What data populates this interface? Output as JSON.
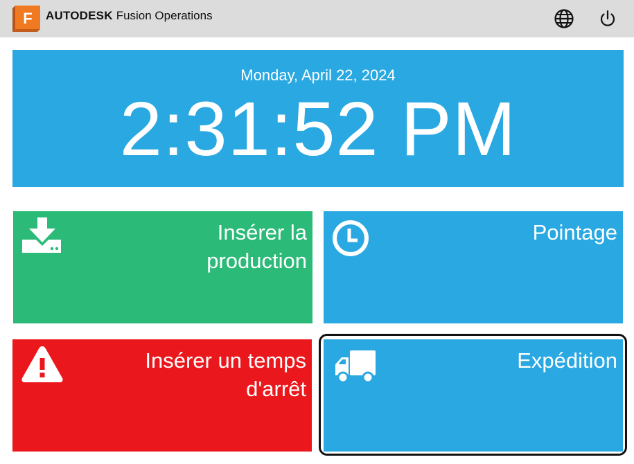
{
  "header": {
    "brand_bold": "AUTODESK",
    "brand_product": "Fusion Operations",
    "logo_letter": "F",
    "logo_color": "#f07a22",
    "icons": [
      "globe-icon",
      "power-icon"
    ]
  },
  "clock": {
    "date": "Monday, April 22, 2024",
    "time": "2:31:52 PM",
    "color": "#29a8e2"
  },
  "tiles": [
    {
      "label_line1": "Insérer la",
      "label_line2": "production",
      "icon": "download-icon",
      "color": "#2bba78"
    },
    {
      "label_line1": "Pointage",
      "label_line2": "",
      "icon": "clock-icon",
      "color": "#29a8e2"
    },
    {
      "label_line1": "Insérer un temps",
      "label_line2": "d'arrêt",
      "icon": "warning-icon",
      "color": "#ea181c"
    },
    {
      "label_line1": "Expédition",
      "label_line2": "",
      "icon": "truck-icon",
      "color": "#29a8e2",
      "focused": true
    }
  ]
}
